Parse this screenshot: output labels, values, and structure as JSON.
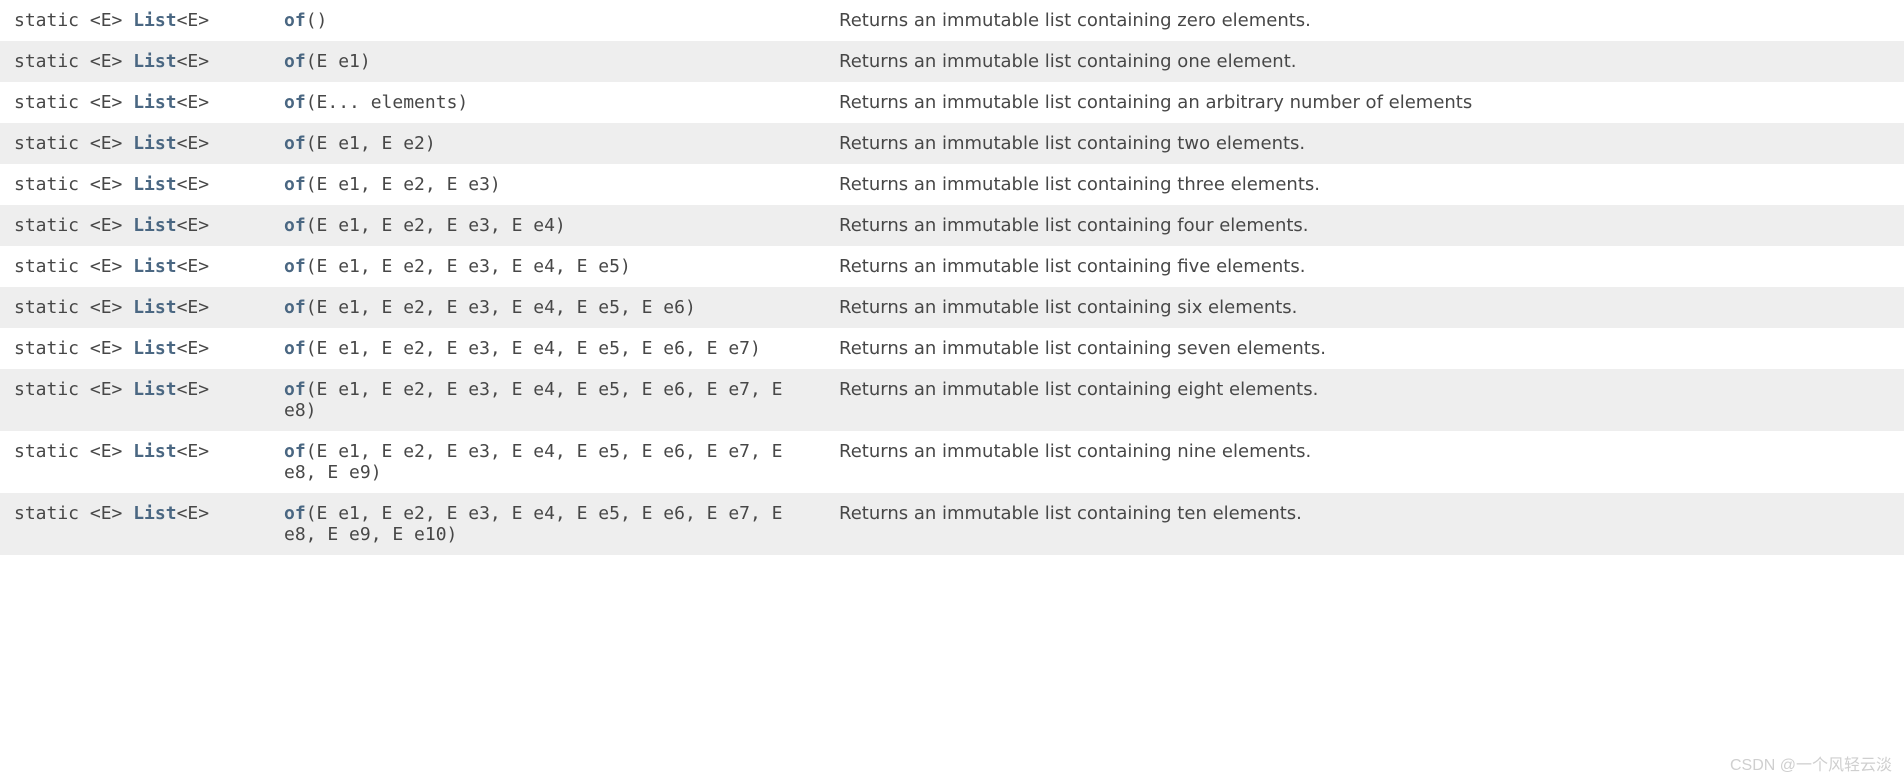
{
  "constants": {
    "modifier": "static <E> ",
    "return_bold": "List",
    "return_suffix": "<E>",
    "method_name": "of"
  },
  "rows": [
    {
      "params": "()",
      "desc": "Returns an immutable list containing zero elements."
    },
    {
      "params": "(E e1)",
      "desc": "Returns an immutable list containing one element."
    },
    {
      "params": "(E... elements)",
      "desc": "Returns an immutable list containing an arbitrary number of elements"
    },
    {
      "params": "(E e1, E e2)",
      "desc": "Returns an immutable list containing two elements."
    },
    {
      "params": "(E e1, E e2, E e3)",
      "desc": "Returns an immutable list containing three elements."
    },
    {
      "params": "(E e1, E e2, E e3, E e4)",
      "desc": "Returns an immutable list containing four elements."
    },
    {
      "params": "(E e1, E e2, E e3, E e4, E e5)",
      "desc": "Returns an immutable list containing five elements."
    },
    {
      "params": "(E e1, E e2, E e3, E e4, E e5, E e6)",
      "desc": "Returns an immutable list containing six elements."
    },
    {
      "params": "(E e1, E e2, E e3, E e4, E e5, E e6, E e7)",
      "desc": "Returns an immutable list containing seven elements."
    },
    {
      "params": "(E e1, E e2, E e3, E e4, E e5, E e6, E e7, E e8)",
      "desc": "Returns an immutable list containing eight elements."
    },
    {
      "params": "(E e1, E e2, E e3, E e4, E e5, E e6, E e7, E e8, E e9)",
      "desc": "Returns an immutable list containing nine elements."
    },
    {
      "params": "(E e1, E e2, E e3, E e4, E e5, E e6, E e7, E e8, E e9, E e10)",
      "desc": "Returns an immutable list containing ten elements."
    }
  ],
  "watermark": "CSDN @一个风轻云淡"
}
